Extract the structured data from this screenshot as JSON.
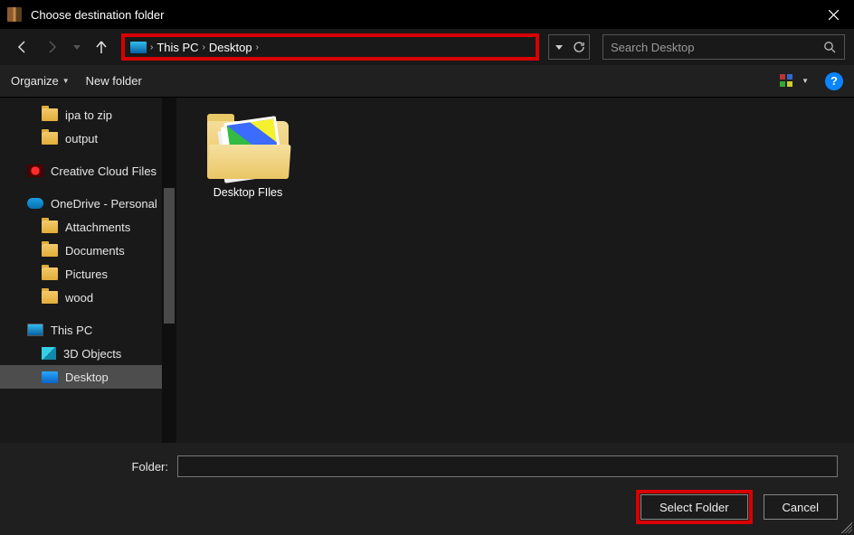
{
  "window": {
    "title": "Choose destination folder"
  },
  "breadcrumb": {
    "items": [
      "This PC",
      "Desktop"
    ]
  },
  "search": {
    "placeholder": "Search Desktop"
  },
  "toolbar": {
    "organize": "Organize",
    "newfolder": "New folder"
  },
  "sidebar": {
    "items": [
      {
        "label": "ipa to zip",
        "icon": "folder",
        "indent": 2
      },
      {
        "label": "output",
        "icon": "folder",
        "indent": 2
      },
      {
        "gap": true
      },
      {
        "label": "Creative Cloud Files",
        "icon": "cc",
        "indent": 1
      },
      {
        "gap": true
      },
      {
        "label": "OneDrive - Personal",
        "icon": "onedrive",
        "indent": 1
      },
      {
        "label": "Attachments",
        "icon": "folder",
        "indent": 2
      },
      {
        "label": "Documents",
        "icon": "folder",
        "indent": 2
      },
      {
        "label": "Pictures",
        "icon": "folder",
        "indent": 2
      },
      {
        "label": "wood",
        "icon": "folder",
        "indent": 2
      },
      {
        "gap": true
      },
      {
        "label": "This PC",
        "icon": "pcicon",
        "indent": 1
      },
      {
        "label": "3D Objects",
        "icon": "cube",
        "indent": 2
      },
      {
        "label": "Desktop",
        "icon": "desktop-sel",
        "indent": 2,
        "selected": true
      }
    ]
  },
  "content": {
    "items": [
      {
        "label": "Desktop FIles",
        "type": "folder-with-photos"
      }
    ]
  },
  "footer": {
    "folder_label": "Folder:",
    "folder_value": "",
    "select_label": "Select Folder",
    "cancel_label": "Cancel"
  },
  "help_icon_text": "?"
}
